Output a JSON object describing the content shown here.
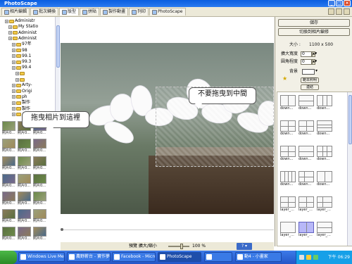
{
  "window": {
    "title": "PhotoScape"
  },
  "tabs": [
    {
      "label": "相片編輯"
    },
    {
      "label": "批次轉換"
    },
    {
      "label": "版型"
    },
    {
      "label": "拼貼"
    },
    {
      "label": "製作動畫"
    },
    {
      "label": "列印"
    },
    {
      "label": "PhotoScape"
    }
  ],
  "tree": [
    {
      "label": "Administr",
      "indent": 1,
      "folder": true
    },
    {
      "label": "My Statio",
      "indent": 2,
      "folder": true
    },
    {
      "label": "Administ",
      "indent": 2,
      "folder": true
    },
    {
      "label": "Administ",
      "indent": 2,
      "folder": true
    },
    {
      "label": "97年",
      "indent": 3,
      "folder": true
    },
    {
      "label": "98",
      "indent": 3,
      "folder": true
    },
    {
      "label": "99.1",
      "indent": 3,
      "folder": true
    },
    {
      "label": "99.3",
      "indent": 3,
      "folder": true
    },
    {
      "label": "99.4",
      "indent": 3,
      "folder": true
    },
    {
      "label": "",
      "indent": 4,
      "folder": true
    },
    {
      "label": "",
      "indent": 4,
      "folder": true
    },
    {
      "label": "Arty-",
      "indent": 3,
      "folder": true
    },
    {
      "label": "Origi",
      "indent": 3,
      "folder": true
    },
    {
      "label": "ph",
      "indent": 3,
      "folder": true
    },
    {
      "label": "製作",
      "indent": 3,
      "folder": true
    },
    {
      "label": "製作",
      "indent": 3,
      "folder": true
    },
    {
      "label": "Adobe",
      "indent": 3,
      "folder": true
    }
  ],
  "thumbnails": [
    "照片0...",
    "照片0...",
    "照片0...",
    "照片0...",
    "照片0...",
    "照片0...",
    "照片0...",
    "照片0...",
    "照片0...",
    "照片0...",
    "照片0...",
    "照片0...",
    "照片0...",
    "照片0...",
    "照片0...",
    "照片0...",
    "照片0...",
    "照片0...",
    "照片0...",
    "照片0...",
    "照片0..."
  ],
  "canvas": {
    "callout_left": "拖曳相片到這裡",
    "callout_right": "不要拖曳到中間"
  },
  "statusbar": {
    "preview_label": "預覽 擴大/縮小",
    "zoom": "100 %"
  },
  "rightpanel": {
    "save": "儲存",
    "switch": "切換到相片編修",
    "size_label": "大小 :",
    "size_value": "1100 x 500",
    "margin_label": "擴大寬度",
    "margin_value": "0",
    "round_label": "圓角程度",
    "round_value": "0",
    "bg_label": "背景",
    "template_btn": "範本照明",
    "link_btn": "連結",
    "templates": [
      "down...",
      "down...",
      "down...",
      "down...",
      "down...",
      "down...",
      "down...",
      "down...",
      "down...",
      "down...",
      "down...",
      "down...",
      "layer_...",
      "layer_...",
      "layer_...",
      "layer_...",
      "layer_...",
      "layer_..."
    ]
  },
  "taskbar": {
    "items": [
      {
        "label": "Windows Live Messen..."
      },
      {
        "label": "農野薪台 - 寶作夢..."
      },
      {
        "label": "Facebook - Microsoft..."
      },
      {
        "label": "PhotoScape"
      },
      {
        "label": ""
      },
      {
        "label": "動4 - 小畫家"
      }
    ],
    "clock": "下午 06:29"
  },
  "colors": {
    "titlebar": "#0a5ee0",
    "taskbar": "#2456c8",
    "panel_bg": "#ece9d8",
    "selected_template": "#b8b8f8"
  }
}
